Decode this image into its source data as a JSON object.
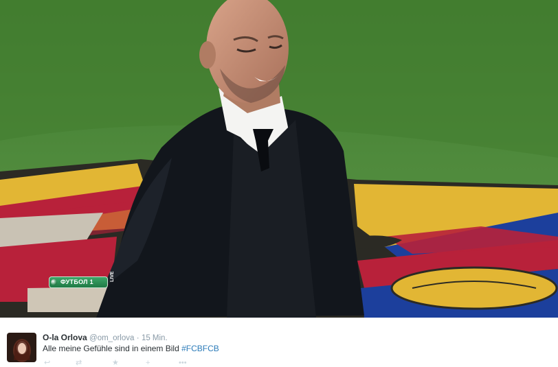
{
  "broadcast": {
    "channel_label": "ФУТБОЛ 1",
    "live_label": "LIVE"
  },
  "tweet": {
    "display_name": "O-la Orlova",
    "handle": "@om_orlova",
    "separator": "·",
    "time": "15 Min.",
    "text": "Alle meine Gefühle sind in einem Bild",
    "hashtag": "#FCBFCB"
  },
  "actions": [
    {
      "name": "reply-icon",
      "glyph": "↩"
    },
    {
      "name": "retweet-icon",
      "glyph": "⇄"
    },
    {
      "name": "favorite-icon",
      "glyph": "★"
    },
    {
      "name": "follow-icon",
      "glyph": "+"
    },
    {
      "name": "more-icon",
      "glyph": "•••"
    }
  ],
  "colors": {
    "pitch_green": "#4e7f3a",
    "crest_blue": "#1c3f9c",
    "crest_red": "#b8213a",
    "crest_gold": "#e2b634",
    "link_blue": "#2b7bb9"
  }
}
